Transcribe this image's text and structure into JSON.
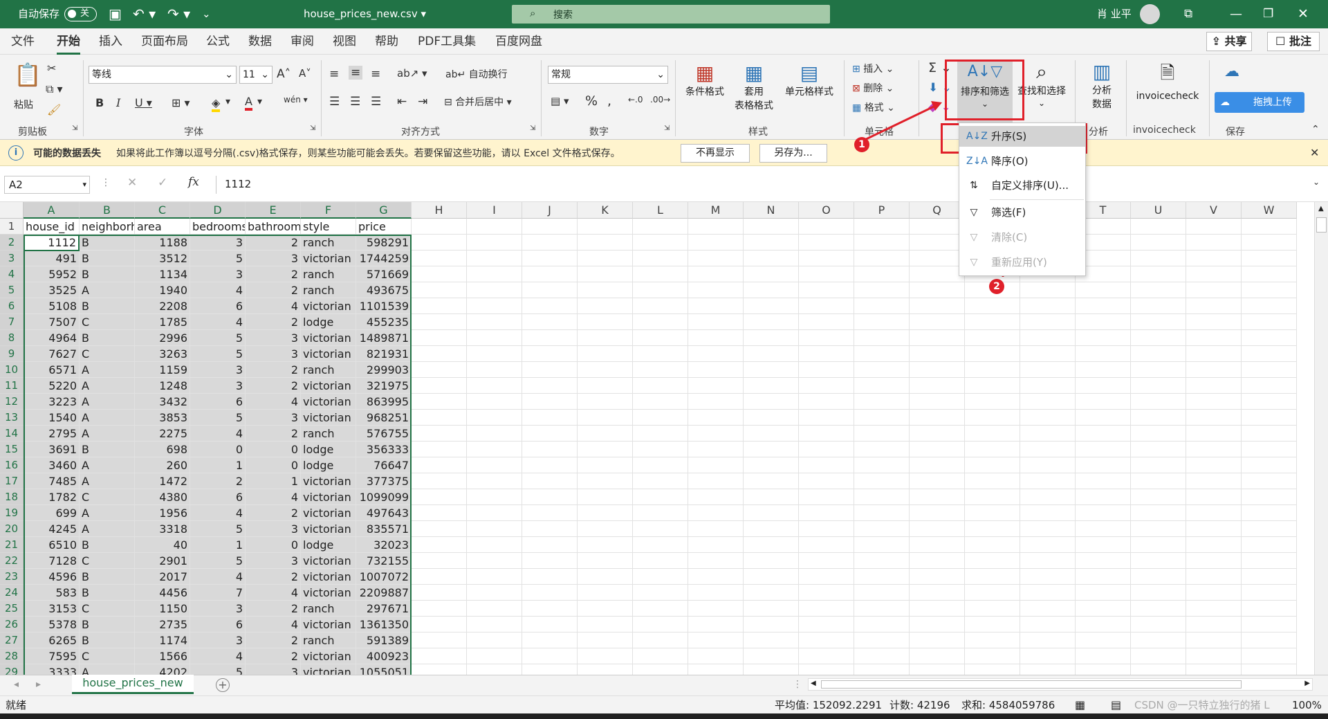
{
  "title": {
    "autosave_label": "自动保存",
    "autosave_state": "关",
    "filename": "house_prices_new.csv",
    "search_label": "搜索",
    "user": "肖 业平"
  },
  "tabs": [
    "文件",
    "开始",
    "插入",
    "页面布局",
    "公式",
    "数据",
    "审阅",
    "视图",
    "帮助",
    "PDF工具集",
    "百度网盘"
  ],
  "share": {
    "share": "共享",
    "comment": "批注"
  },
  "ribbon": {
    "paste": "粘贴",
    "font_name": "等线",
    "font_size": "11",
    "wrap": "自动换行",
    "merge": "合并后居中",
    "number_format": "常规",
    "cond_format": "条件格式",
    "table_format_a": "套用",
    "table_format_b": "表格格式",
    "cell_style": "单元格样式",
    "insert": "插入",
    "delete": "删除",
    "format": "格式",
    "sort_filter": "排序和筛选",
    "find_select": "查找和选择",
    "analyze_a": "分析",
    "analyze_b": "数据",
    "invoicecheck": "invoicecheck",
    "upload": "拖拽上传",
    "groups": {
      "clipboard": "剪贴板",
      "font": "字体",
      "alignment": "对齐方式",
      "number": "数字",
      "styles": "样式",
      "cells": "单元格",
      "analysis": "分析",
      "invoicecheck": "invoicecheck",
      "save": "保存"
    }
  },
  "message": {
    "title": "可能的数据丢失",
    "text": "如果将此工作簿以逗号分隔(.csv)格式保存，则某些功能可能会丢失。若要保留这些功能，请以 Excel 文件格式保存。",
    "btn_dismiss": "不再显示",
    "btn_saveas": "另存为..."
  },
  "formula": {
    "name_box": "A2",
    "fx": "fx",
    "value": "1112"
  },
  "columns": [
    "A",
    "B",
    "C",
    "D",
    "E",
    "F",
    "G",
    "H",
    "I",
    "J",
    "K",
    "L",
    "M",
    "N",
    "O",
    "P",
    "Q",
    "R",
    "S",
    "T",
    "U",
    "V",
    "W"
  ],
  "header_row": [
    "house_id",
    "neighborh",
    "area",
    "bedrooms",
    "bathroom",
    "style",
    "price"
  ],
  "rows": [
    [
      "1112",
      "B",
      "1188",
      "3",
      "2",
      "ranch",
      "598291"
    ],
    [
      "491",
      "B",
      "3512",
      "5",
      "3",
      "victorian",
      "1744259"
    ],
    [
      "5952",
      "B",
      "1134",
      "3",
      "2",
      "ranch",
      "571669"
    ],
    [
      "3525",
      "A",
      "1940",
      "4",
      "2",
      "ranch",
      "493675"
    ],
    [
      "5108",
      "B",
      "2208",
      "6",
      "4",
      "victorian",
      "1101539"
    ],
    [
      "7507",
      "C",
      "1785",
      "4",
      "2",
      "lodge",
      "455235"
    ],
    [
      "4964",
      "B",
      "2996",
      "5",
      "3",
      "victorian",
      "1489871"
    ],
    [
      "7627",
      "C",
      "3263",
      "5",
      "3",
      "victorian",
      "821931"
    ],
    [
      "6571",
      "A",
      "1159",
      "3",
      "2",
      "ranch",
      "299903"
    ],
    [
      "5220",
      "A",
      "1248",
      "3",
      "2",
      "victorian",
      "321975"
    ],
    [
      "3223",
      "A",
      "3432",
      "6",
      "4",
      "victorian",
      "863995"
    ],
    [
      "1540",
      "A",
      "3853",
      "5",
      "3",
      "victorian",
      "968251"
    ],
    [
      "2795",
      "A",
      "2275",
      "4",
      "2",
      "ranch",
      "576755"
    ],
    [
      "3691",
      "B",
      "698",
      "0",
      "0",
      "lodge",
      "356333"
    ],
    [
      "3460",
      "A",
      "260",
      "1",
      "0",
      "lodge",
      "76647"
    ],
    [
      "7485",
      "A",
      "1472",
      "2",
      "1",
      "victorian",
      "377375"
    ],
    [
      "1782",
      "C",
      "4380",
      "6",
      "4",
      "victorian",
      "1099099"
    ],
    [
      "699",
      "A",
      "1956",
      "4",
      "2",
      "victorian",
      "497643"
    ],
    [
      "4245",
      "A",
      "3318",
      "5",
      "3",
      "victorian",
      "835571"
    ],
    [
      "6510",
      "B",
      "40",
      "1",
      "0",
      "lodge",
      "32023"
    ],
    [
      "7128",
      "C",
      "2901",
      "5",
      "3",
      "victorian",
      "732155"
    ],
    [
      "4596",
      "B",
      "2017",
      "4",
      "2",
      "victorian",
      "1007072"
    ],
    [
      "583",
      "B",
      "4456",
      "7",
      "4",
      "victorian",
      "2209887"
    ],
    [
      "3153",
      "C",
      "1150",
      "3",
      "2",
      "ranch",
      "297671"
    ],
    [
      "5378",
      "B",
      "2735",
      "6",
      "4",
      "victorian",
      "1361350"
    ],
    [
      "6265",
      "B",
      "1174",
      "3",
      "2",
      "ranch",
      "591389"
    ],
    [
      "7595",
      "C",
      "1566",
      "4",
      "2",
      "victorian",
      "400923"
    ],
    [
      "3333",
      "A",
      "4202",
      "5",
      "3",
      "victorian",
      "1055051"
    ]
  ],
  "sort_menu": {
    "asc": "升序(S)",
    "desc": "降序(O)",
    "custom": "自定义排序(U)...",
    "filter": "筛选(F)",
    "clear": "清除(C)",
    "reapply": "重新应用(Y)"
  },
  "annotations": [
    "1",
    "2"
  ],
  "sheet_tab": "house_prices_new",
  "status": {
    "ready": "就绪",
    "average": "平均值: 152092.2291",
    "count": "计数: 42196",
    "sum": "求和: 4584059786",
    "watermark": "CSDN @一只特立独行的猪 L",
    "zoom": "100%"
  },
  "colors": {
    "excel_green": "#217346",
    "annotation_red": "#e0202a",
    "message_bar": "#fff4ce"
  }
}
